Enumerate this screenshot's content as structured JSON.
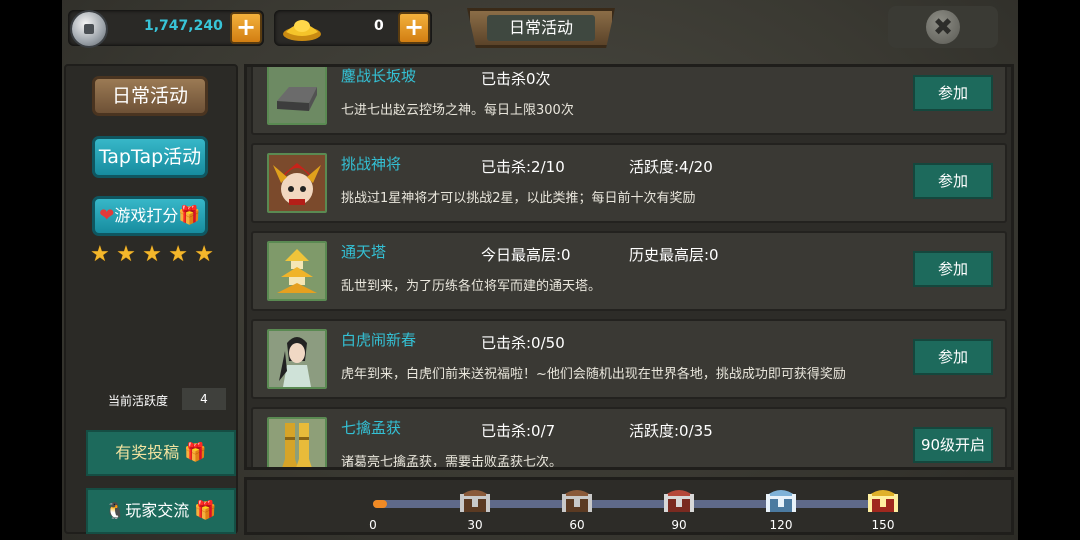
{
  "top_bar": {
    "silver_amount": "1,747,240",
    "gold_amount": "0",
    "plus_label": "+",
    "title": "日常活动",
    "close_label": "✖"
  },
  "sidebar": {
    "daily_label": "日常活动",
    "taptap_label": "TapTap活动",
    "rate_label": "游戏打分",
    "stars": 5,
    "star_glyph": "★",
    "activity_label": "当前活跃度",
    "activity_value": "4",
    "submission_label": "有奖投稿",
    "community_label": "玩家交流"
  },
  "activities": [
    {
      "name": "鏖战长坂坡",
      "stat1": "已击杀0次",
      "stat2": "",
      "desc": "七进七出赵云控场之神。每日上限300次",
      "button": "参加",
      "icon": "iron-ingot-icon"
    },
    {
      "name": "挑战神将",
      "stat1": "已击杀:2/10",
      "stat2": "活跃度:4/20",
      "desc": "挑战过1星神将才可以挑战2星，以此类推；每日前十次有奖励",
      "button": "参加",
      "icon": "red-general-icon"
    },
    {
      "name": "通天塔",
      "stat1": "今日最高层:0",
      "stat2": "历史最高层:0",
      "desc": "乱世到来，为了历练各位将军而建的通天塔。",
      "button": "参加",
      "icon": "pagoda-icon"
    },
    {
      "name": "白虎闹新春",
      "stat1": "已击杀:0/50",
      "stat2": "",
      "desc": "虎年到来，白虎们前来送祝福啦！~他们会随机出现在世界各地，挑战成功即可获得奖励",
      "button": "参加",
      "icon": "white-robed-hero-icon"
    },
    {
      "name": "七擒孟获",
      "stat1": "已击杀:0/7",
      "stat2": "活跃度:0/35",
      "desc": "诸葛亮七擒孟获，需要击败孟获七次。",
      "button": "90级开启",
      "icon": "golden-boots-icon"
    }
  ],
  "progress": {
    "current": 4,
    "max": 150,
    "milestones": [
      {
        "label": "0",
        "value": 0,
        "chest": null
      },
      {
        "label": "30",
        "value": 30,
        "chest": "bronze-chest-icon"
      },
      {
        "label": "60",
        "value": 60,
        "chest": "bronze-chest-icon"
      },
      {
        "label": "90",
        "value": 90,
        "chest": "red-chest-icon"
      },
      {
        "label": "120",
        "value": 120,
        "chest": "blue-chest-icon"
      },
      {
        "label": "150",
        "value": 150,
        "chest": "gold-chest-icon"
      }
    ]
  }
}
